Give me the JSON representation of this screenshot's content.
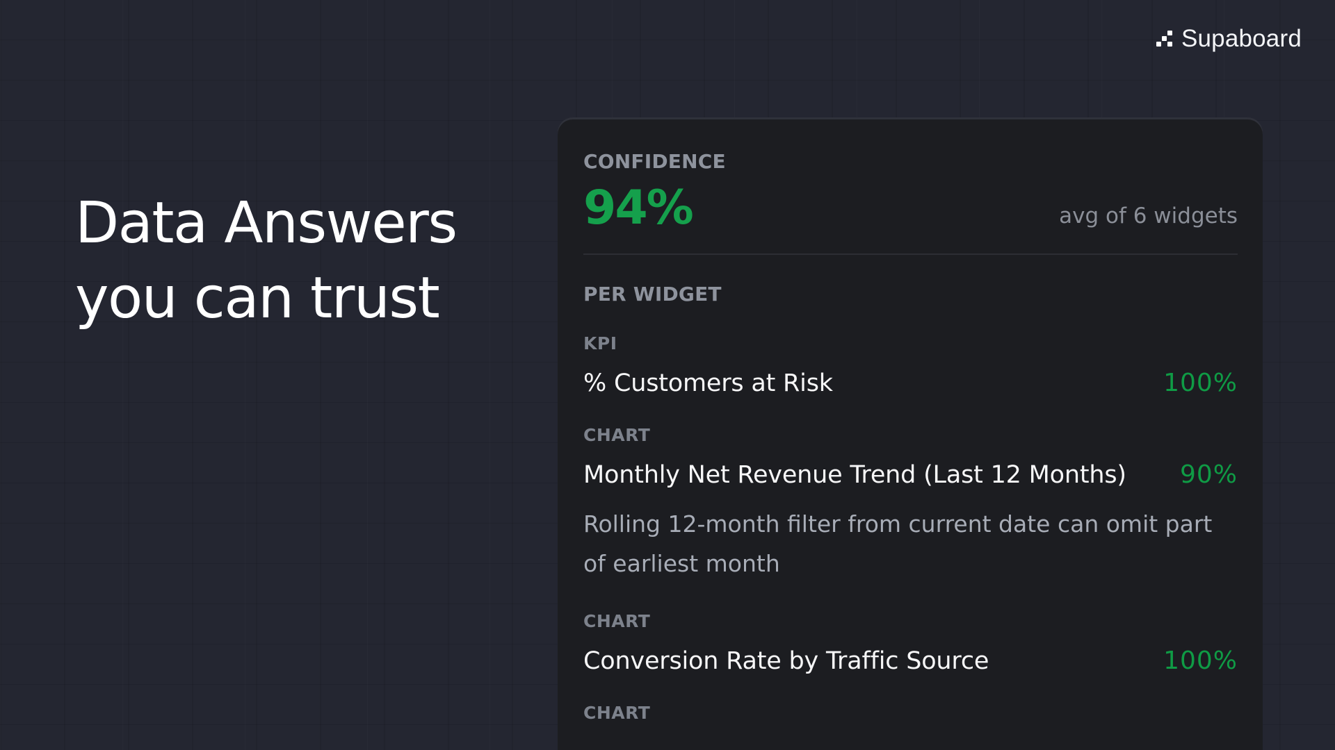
{
  "brand": {
    "name": "Supaboard",
    "logo_icon": "pixel-steps-icon"
  },
  "headline": {
    "line1": "Data Answers",
    "line2": "you can trust"
  },
  "confidence": {
    "title": "CONFIDENCE",
    "value": "94%",
    "note": "avg of 6 widgets"
  },
  "per_widget": {
    "title": "PER WIDGET",
    "widgets": [
      {
        "type": "KPI",
        "name": "% Customers at Risk",
        "score": "100%",
        "note": ""
      },
      {
        "type": "CHART",
        "name": "Monthly Net Revenue Trend (Last 12 Months)",
        "score": "90%",
        "note": "Rolling 12-month filter from current date can omit part of earliest month"
      },
      {
        "type": "CHART",
        "name": "Conversion Rate by Traffic Source",
        "score": "100%",
        "note": ""
      },
      {
        "type": "CHART",
        "name": "",
        "score": "",
        "note": ""
      }
    ]
  },
  "colors": {
    "background": "#242631",
    "panel": "#1c1d21",
    "success": "#15a04c"
  }
}
